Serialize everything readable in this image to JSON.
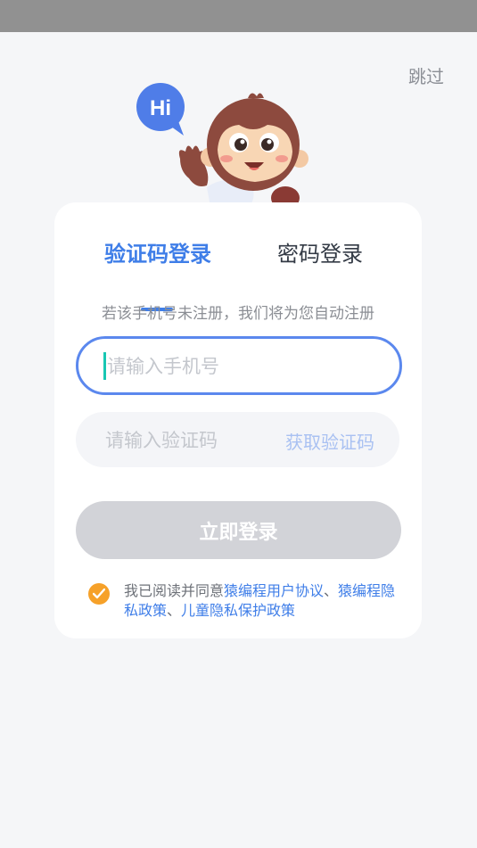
{
  "header": {
    "skip_label": "跳过"
  },
  "mascot": {
    "bubble_text": "Hi"
  },
  "tabs": [
    {
      "label": "验证码登录",
      "active": true
    },
    {
      "label": "密码登录",
      "active": false
    }
  ],
  "hint": "若该手机号未注册，我们将为您自动注册",
  "phone": {
    "placeholder": "请输入手机号",
    "value": ""
  },
  "code": {
    "placeholder": "请输入验证码",
    "value": "",
    "get_code_label": "获取验证码"
  },
  "login_button": "立即登录",
  "agreement": {
    "checked": true,
    "prefix": "我已阅读并同意",
    "link1": "猿编程用户协议",
    "sep1": "、",
    "link2": "猿编程隐私政策",
    "sep2": "、",
    "link3": "儿童隐私保护政策"
  },
  "colors": {
    "accent": "#3f7ee8",
    "input_border": "#5b88ee",
    "checkbox": "#f6a129",
    "disabled_button": "#d2d3d8"
  }
}
